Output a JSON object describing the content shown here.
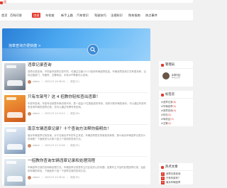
{
  "nav": {
    "logo_text": "翔",
    "items": [
      {
        "label": "首页",
        "active": false
      },
      {
        "label": "百科问答",
        "active": false
      },
      {
        "label": "违规",
        "active": true
      },
      {
        "label": "年检查",
        "active": false
      },
      {
        "label": "新手上路",
        "active": false
      },
      {
        "label": "汽车常识",
        "active": false
      },
      {
        "label": "驾驶技巧",
        "active": false
      },
      {
        "label": "法规知识",
        "active": false
      },
      {
        "label": "购车指南",
        "active": false
      },
      {
        "label": "热点事件",
        "active": false
      }
    ]
  },
  "banner": {
    "title": "违章查询方便快捷 >",
    "button_icon": "search-icon"
  },
  "articles": [
    {
      "title": "违章记录查询",
      "desc": "违章记录查询。不同省市违章记录不同，可通过交管12123查询车辆违章信息。车辆违章查询方式有很多种，当地交管部门、车管所、交警网站、手机APP等都可以查询。",
      "author": "admin",
      "date": "2023-07-16 08:34",
      "views": "浏览(21)"
    },
    {
      "title": "只有车架号？这 4 招教你轻松查出违章！",
      "desc": "车架号查询。车架号也就是车辆识别代号，是一组由17位数组成的号码，用来识别车辆的身份，可以通过车架号来查询车辆的违章记录，也可以通过车牌号来查询。",
      "author": "admin",
      "date": "2023-07-14 15:12",
      "views": "浏览(18)"
    },
    {
      "title": "南京车辆违章记录？十个查询方法帮你搞明白！",
      "desc": "南京车辆违章记录查询。对于在南京开车的车主来说，车辆违章是在所难免的事情，那么南京车辆违章记录怎么查询呢？下面就来为大家介绍几个常用的查询方法。",
      "author": "admin",
      "date": "2023-07-12 10:05",
      "views": "浏览(25)"
    },
    {
      "title": "一招教你查询车辆违章记录和处理流程",
      "desc": "车辆违章记录的查询和处理方法。车辆违章记录是车主们比较关心的问题，如果车主不及时处理违章记录，会影响车辆的年检，下面就来介绍一下违章记录的查询方法。",
      "author": "admin",
      "date": "2023-07-10 09:41",
      "views": "浏览(30)"
    }
  ],
  "sidebar": {
    "admin_box": {
      "title": "管理员",
      "name": "admin",
      "desc": "车主之家"
    },
    "tags_box": {
      "title": "标签云",
      "items": [
        {
          "label": "#违章记录",
          "num": "(6)"
        },
        {
          "label": "#车辆违章",
          "num": "(5)"
        },
        {
          "label": "#违章查询",
          "num": "(4)"
        },
        {
          "label": "#年检",
          "num": "(3)"
        },
        {
          "label": "#驾驶证",
          "num": "(3)"
        },
        {
          "label": "#交警",
          "num": "(2)"
        }
      ]
    },
    "hot_box": {
      "title": "热点文章",
      "items": [
        {
          "rank": "1",
          "title": "违章记录查询"
        },
        {
          "rank": "2",
          "title": "只有车架号？"
        },
        {
          "rank": "3",
          "title": "南京车辆违章"
        }
      ]
    }
  },
  "colors": {
    "accent": "#e23a2e",
    "banner_blue": "#4aa6ef"
  }
}
